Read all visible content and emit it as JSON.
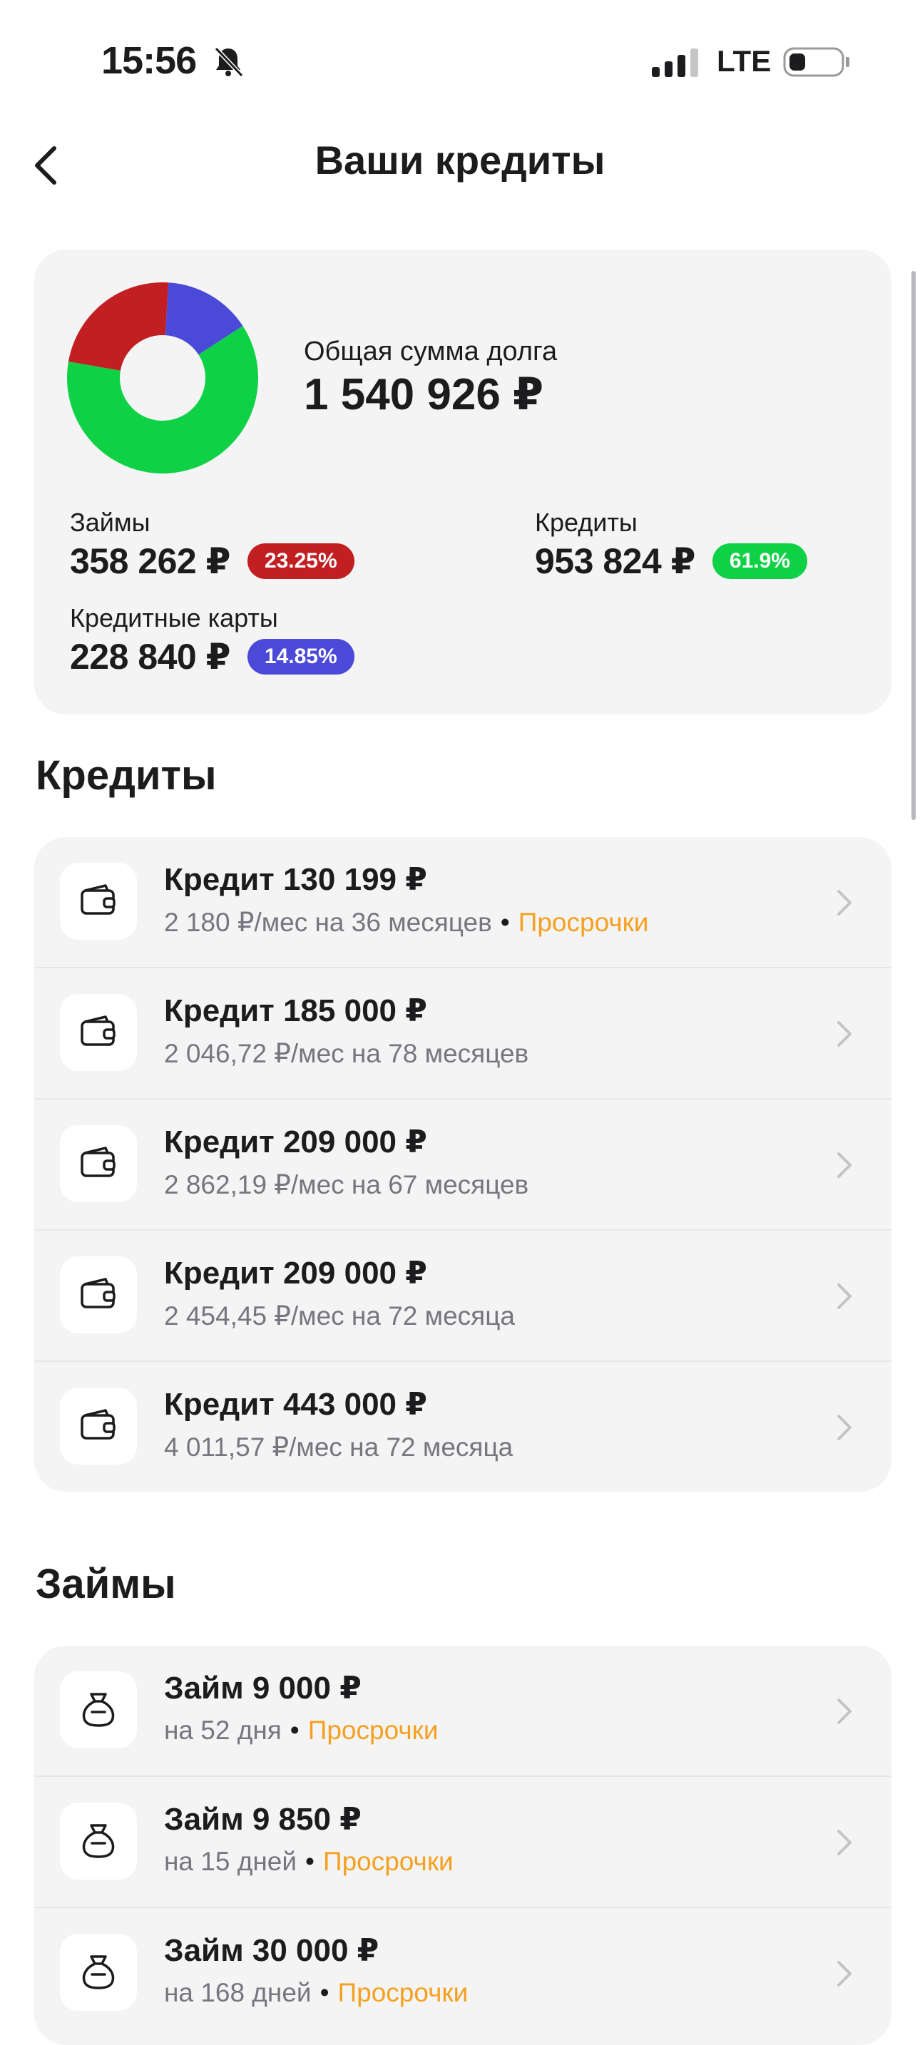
{
  "status_bar": {
    "time": "15:56",
    "network": "LTE"
  },
  "header": {
    "title": "Ваши кредиты"
  },
  "summary": {
    "total_label": "Общая сумма долга",
    "total_value": "1 540 926 ₽",
    "segments": [
      {
        "name": "Кредиты",
        "percent": 61.9,
        "color": "#0fd146"
      },
      {
        "name": "Займы",
        "percent": 23.25,
        "color": "#c21f22"
      },
      {
        "name": "Кредитные карты",
        "percent": 14.85,
        "color": "#4a49d8"
      }
    ],
    "loans": {
      "label": "Займы",
      "value": "358 262 ₽",
      "badge": "23.25%",
      "color": "#c21f22"
    },
    "credits": {
      "label": "Кредиты",
      "value": "953 824 ₽",
      "badge": "61.9%",
      "color": "#0fd146"
    },
    "cards": {
      "label": "Кредитные карты",
      "value": "228 840 ₽",
      "badge": "14.85%",
      "color": "#4a49d8"
    }
  },
  "credits_section": {
    "title": "Кредиты",
    "items": [
      {
        "title": "Кредит 130 199 ₽",
        "subtitle": "2 180 ₽/мес на 36 месяцев",
        "overdue": "Просрочки"
      },
      {
        "title": "Кредит 185 000 ₽",
        "subtitle": "2 046,72 ₽/мес на 78 месяцев",
        "overdue": ""
      },
      {
        "title": "Кредит 209 000 ₽",
        "subtitle": "2 862,19 ₽/мес на 67 месяцев",
        "overdue": ""
      },
      {
        "title": "Кредит 209 000 ₽",
        "subtitle": "2 454,45 ₽/мес на 72 месяца",
        "overdue": ""
      },
      {
        "title": "Кредит 443 000 ₽",
        "subtitle": "4 011,57 ₽/мес на 72 месяца",
        "overdue": ""
      }
    ]
  },
  "loans_section": {
    "title": "Займы",
    "items": [
      {
        "title": "Займ 9 000 ₽",
        "subtitle": "на 52 дня",
        "overdue": "Просрочки"
      },
      {
        "title": "Займ 9 850 ₽",
        "subtitle": "на 15 дней",
        "overdue": "Просрочки"
      },
      {
        "title": "Займ 30 000 ₽",
        "subtitle": "на 168 дней",
        "overdue": "Просрочки"
      }
    ]
  },
  "colors": {
    "overdue": "#f5a020",
    "card_bg": "#f4f4f4"
  }
}
